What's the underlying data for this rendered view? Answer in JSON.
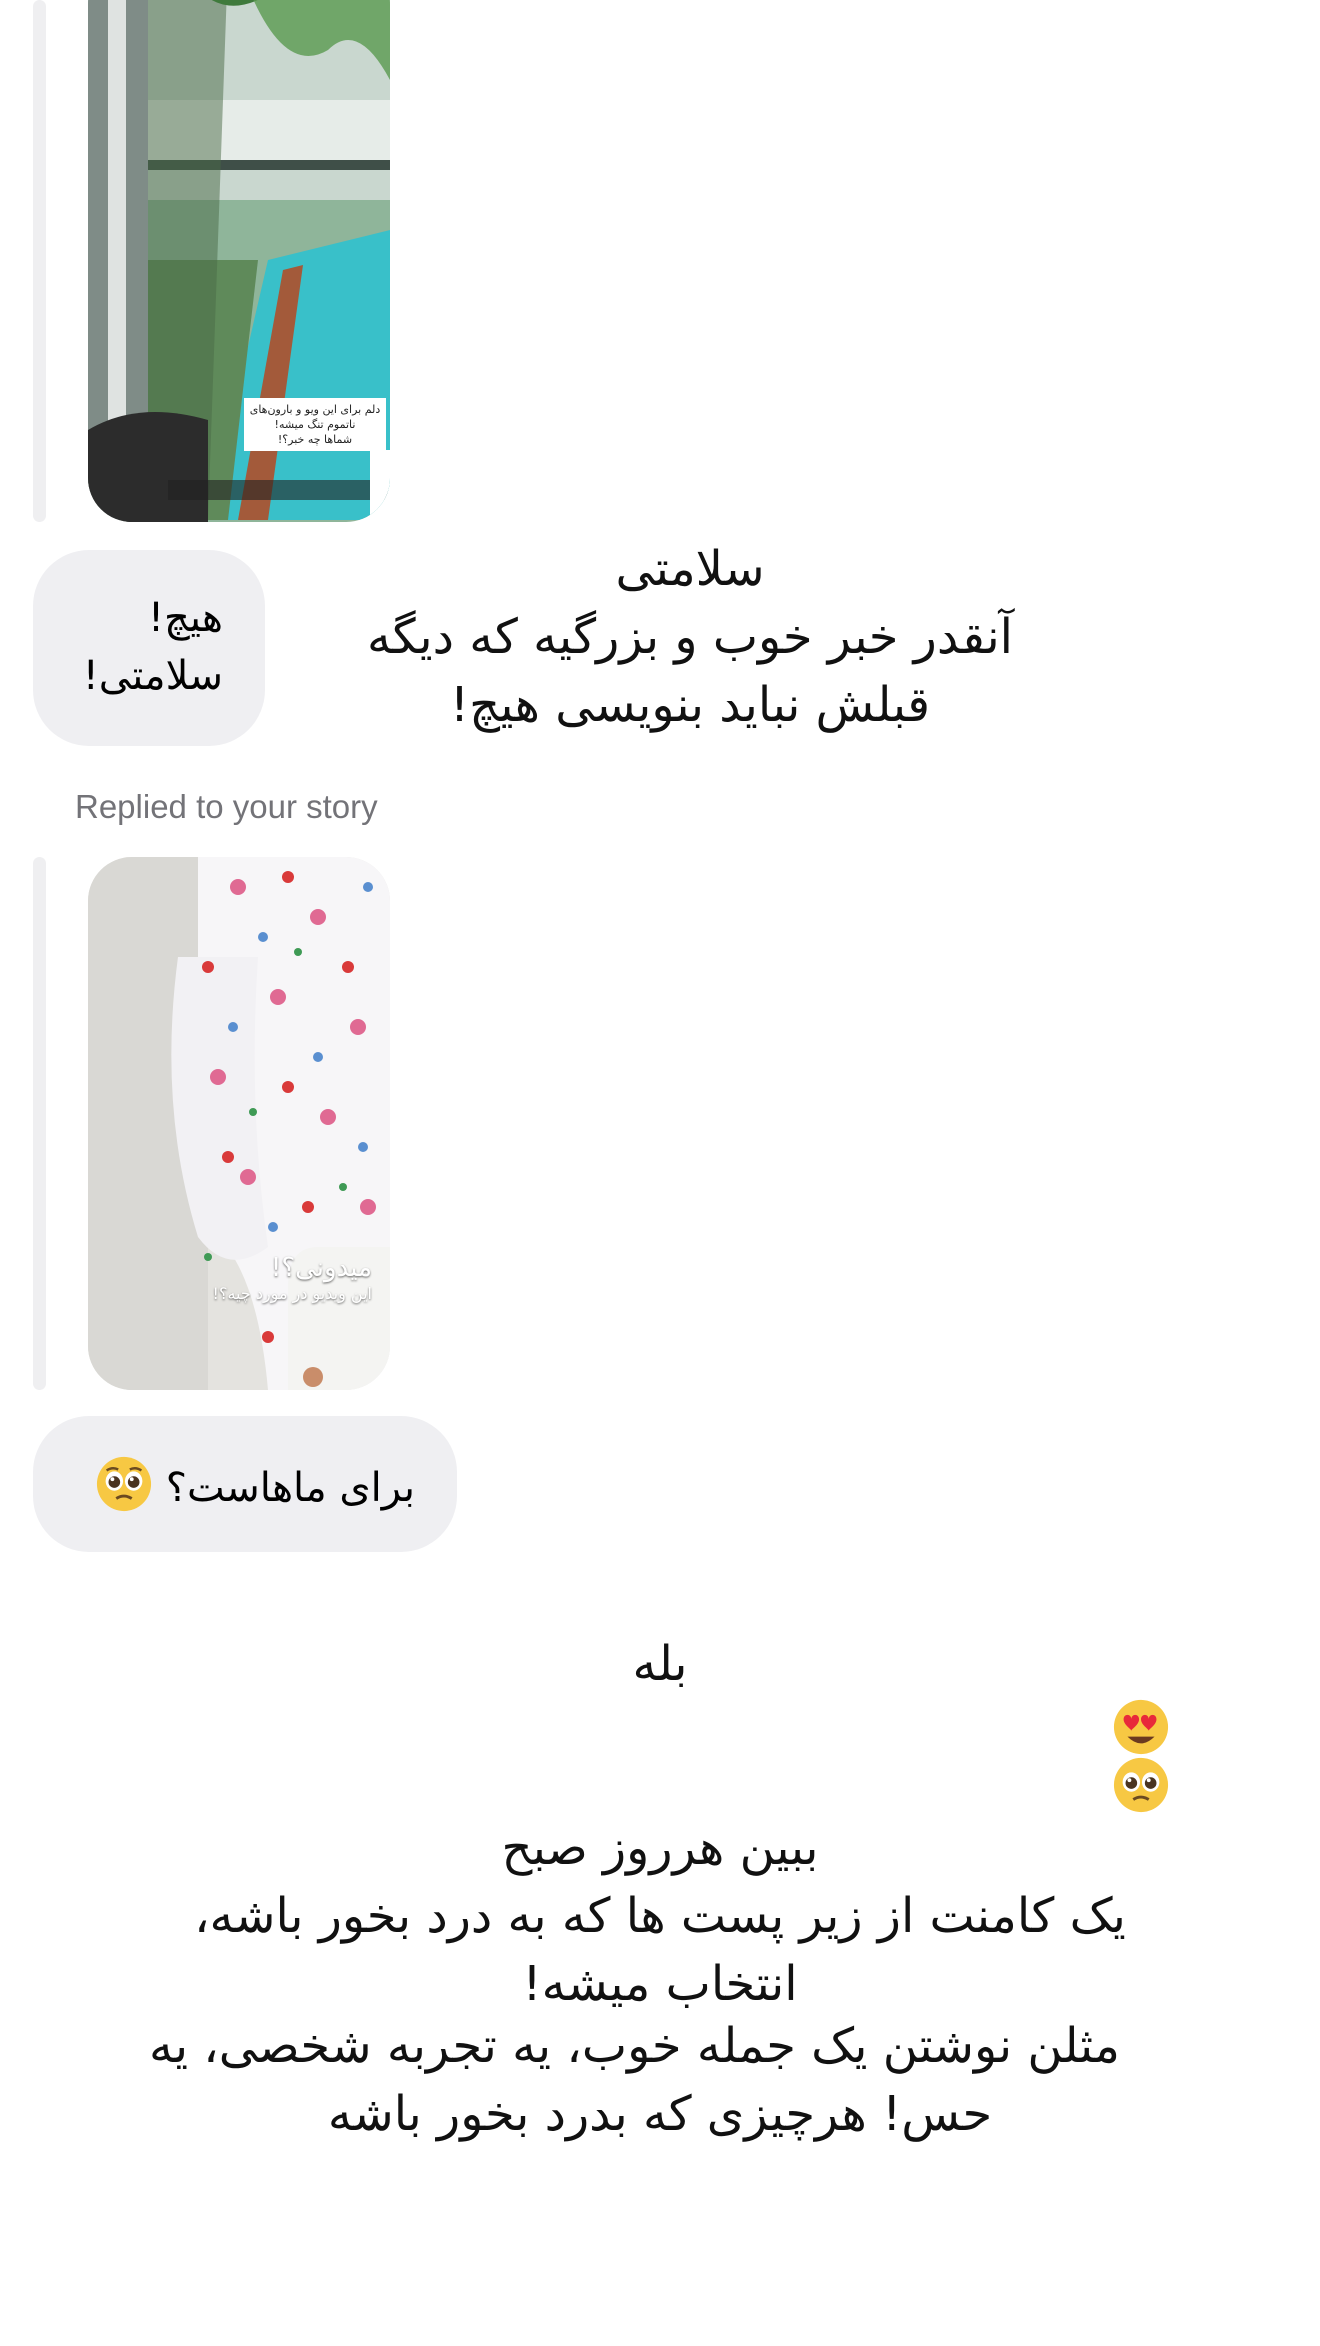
{
  "thread": {
    "reply_caption": "Replied to your story",
    "story1": {
      "overlay_lines": [
        "دلم برای این ویو و بارون‌های",
        "ناتموم تنگ میشه!",
        "شماها چه خبر؟!"
      ]
    },
    "bubble1": {
      "lines": [
        "هیچ!",
        "سلامتی!"
      ]
    },
    "text_block1": {
      "lines": [
        "سلامتی",
        "آنقدر خبر خوب و بزرگیه که دیگه",
        "قبلش نباید بنویسی هیچ!"
      ]
    },
    "story2": {
      "overlay_title": "میدونی؟!",
      "overlay_sub": "این ویدیو در مورد چیه؟!"
    },
    "bubble2": {
      "text": "برای ماهاست؟",
      "emoji": "pleading-face"
    },
    "text_block2": {
      "first_line_word": "بله",
      "first_line_emojis": [
        "heart-eyes-face",
        "pleading-face"
      ],
      "lines": [
        "ببین هرروز صبح",
        "یک کامنت از زیر پست ها که به درد بخور باشه،",
        "انتخاب میشه!"
      ]
    },
    "text_block3": {
      "lines": [
        "مثلن نوشتن یک جمله خوب، یه تجربه شخصی، یه",
        "حس! هرچیزی که بدرد بخور باشه"
      ]
    }
  },
  "colors": {
    "bubble_bg": "#efeff2",
    "reply_bar": "#efeff1",
    "caption_gray": "#737378",
    "pool_water": "#39c0c9",
    "deck_wood": "#a35a3a"
  }
}
